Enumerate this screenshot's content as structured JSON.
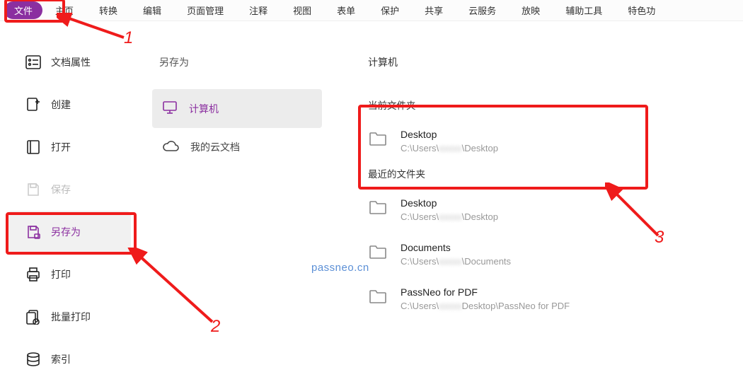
{
  "ribbon": {
    "file": "文件",
    "tabs": [
      "主页",
      "转换",
      "编辑",
      "页面管理",
      "注释",
      "视图",
      "表单",
      "保护",
      "共享",
      "云服务",
      "放映",
      "辅助工具",
      "特色功"
    ]
  },
  "filemenu": {
    "docprops": "文档属性",
    "create": "创建",
    "open": "打开",
    "save": "保存",
    "saveas": "另存为",
    "print": "打印",
    "batchprint": "批量打印",
    "index": "索引"
  },
  "midcol": {
    "title": "另存为",
    "computer": "计算机",
    "cloud": "我的云文档"
  },
  "rightcol": {
    "title": "计算机",
    "current_label": "当前文件夹",
    "recent_label": "最近的文件夹",
    "current": {
      "name": "Desktop",
      "path_pre": "C:\\Users\\",
      "path_hidden": "xxxxx",
      "path_post": "\\Desktop"
    },
    "recent": [
      {
        "name": "Desktop",
        "path_pre": "C:\\Users\\",
        "path_hidden": "xxxxx",
        "path_post": "\\Desktop"
      },
      {
        "name": "Documents",
        "path_pre": "C:\\Users\\",
        "path_hidden": "xxxxx",
        "path_post": "\\Documents"
      },
      {
        "name": "PassNeo for PDF",
        "path_pre": "C:\\Users\\",
        "path_hidden": "xxxxx",
        "path_post": "Desktop\\PassNeo for PDF"
      }
    ]
  },
  "annotations": {
    "n1": "1",
    "n2": "2",
    "n3": "3"
  },
  "watermark": "passneo.cn"
}
